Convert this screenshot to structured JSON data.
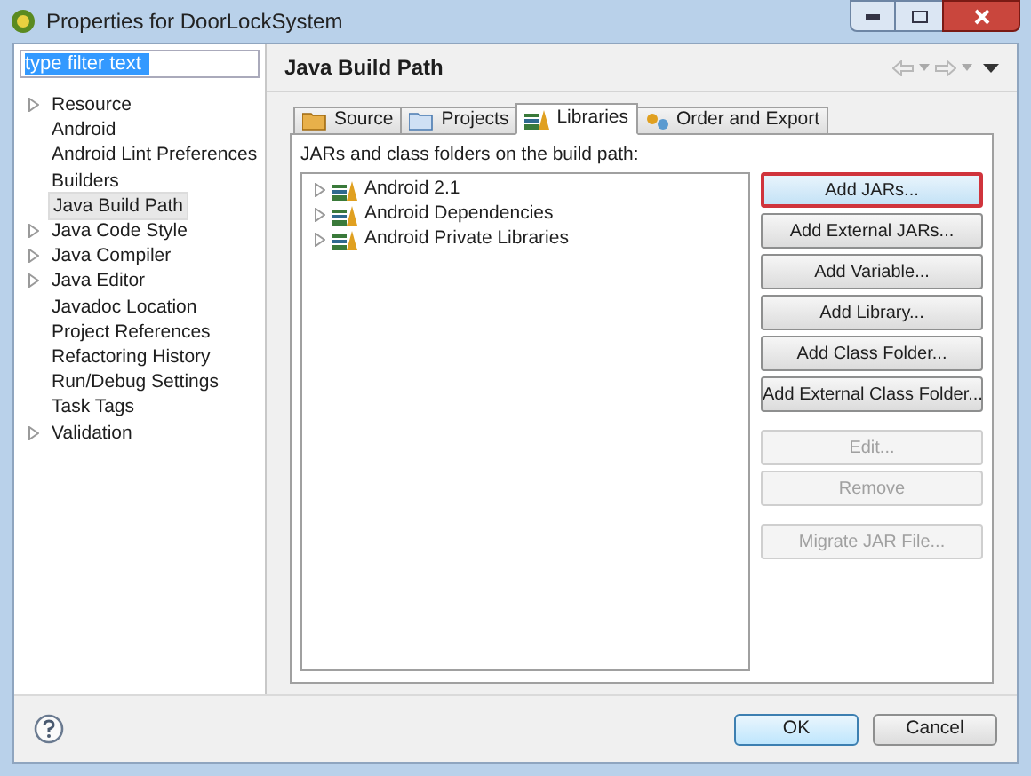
{
  "window": {
    "title": "Properties for DoorLockSystem"
  },
  "filter": {
    "value": "type filter text"
  },
  "sidebar": {
    "items": [
      {
        "label": "Resource",
        "kind": "folder",
        "selected": false
      },
      {
        "label": "Android",
        "kind": "leaf",
        "selected": false
      },
      {
        "label": "Android Lint Preferences",
        "kind": "leaf",
        "selected": false
      },
      {
        "label": "Builders",
        "kind": "leaf",
        "selected": false
      },
      {
        "label": "Java Build Path",
        "kind": "leaf",
        "selected": true
      },
      {
        "label": "Java Code Style",
        "kind": "folder",
        "selected": false
      },
      {
        "label": "Java Compiler",
        "kind": "folder",
        "selected": false
      },
      {
        "label": "Java Editor",
        "kind": "folder",
        "selected": false
      },
      {
        "label": "Javadoc Location",
        "kind": "leaf",
        "selected": false
      },
      {
        "label": "Project References",
        "kind": "leaf",
        "selected": false
      },
      {
        "label": "Refactoring History",
        "kind": "leaf",
        "selected": false
      },
      {
        "label": "Run/Debug Settings",
        "kind": "leaf",
        "selected": false
      },
      {
        "label": "Task Tags",
        "kind": "leaf",
        "selected": false
      },
      {
        "label": "Validation",
        "kind": "folder",
        "selected": false
      }
    ]
  },
  "page": {
    "title": "Java Build Path",
    "tabs": [
      {
        "label": "Source",
        "kind": "source",
        "selected": false
      },
      {
        "label": "Projects",
        "kind": "projects",
        "selected": false
      },
      {
        "label": "Libraries",
        "kind": "libraries",
        "selected": true
      },
      {
        "label": "Order and Export",
        "kind": "order",
        "selected": false
      }
    ],
    "description": "JARs and class folders on the build path:",
    "tree": [
      {
        "label": "Android 2.1",
        "expanded": false
      },
      {
        "label": "Android Dependencies",
        "expanded": false
      },
      {
        "label": "Android Private Libraries",
        "expanded": false
      }
    ],
    "button_groups": [
      [
        {
          "label": "Add JARs...",
          "disabled": false,
          "focused": true
        },
        {
          "label": "Add External JARs...",
          "disabled": false,
          "focused": false
        },
        {
          "label": "Add Variable...",
          "disabled": false,
          "focused": false
        },
        {
          "label": "Add Library...",
          "disabled": false,
          "focused": false
        },
        {
          "label": "Add Class Folder...",
          "disabled": false,
          "focused": false
        },
        {
          "label": "Add External Class Folder...",
          "disabled": false,
          "focused": false
        }
      ],
      [
        {
          "label": "Edit...",
          "disabled": true,
          "focused": false
        },
        {
          "label": "Remove",
          "disabled": true,
          "focused": false
        }
      ],
      [
        {
          "label": "Migrate JAR File...",
          "disabled": true,
          "focused": false
        }
      ]
    ]
  },
  "footer": {
    "buttons": [
      {
        "label": "OK",
        "default": true
      },
      {
        "label": "Cancel",
        "default": false
      }
    ]
  }
}
